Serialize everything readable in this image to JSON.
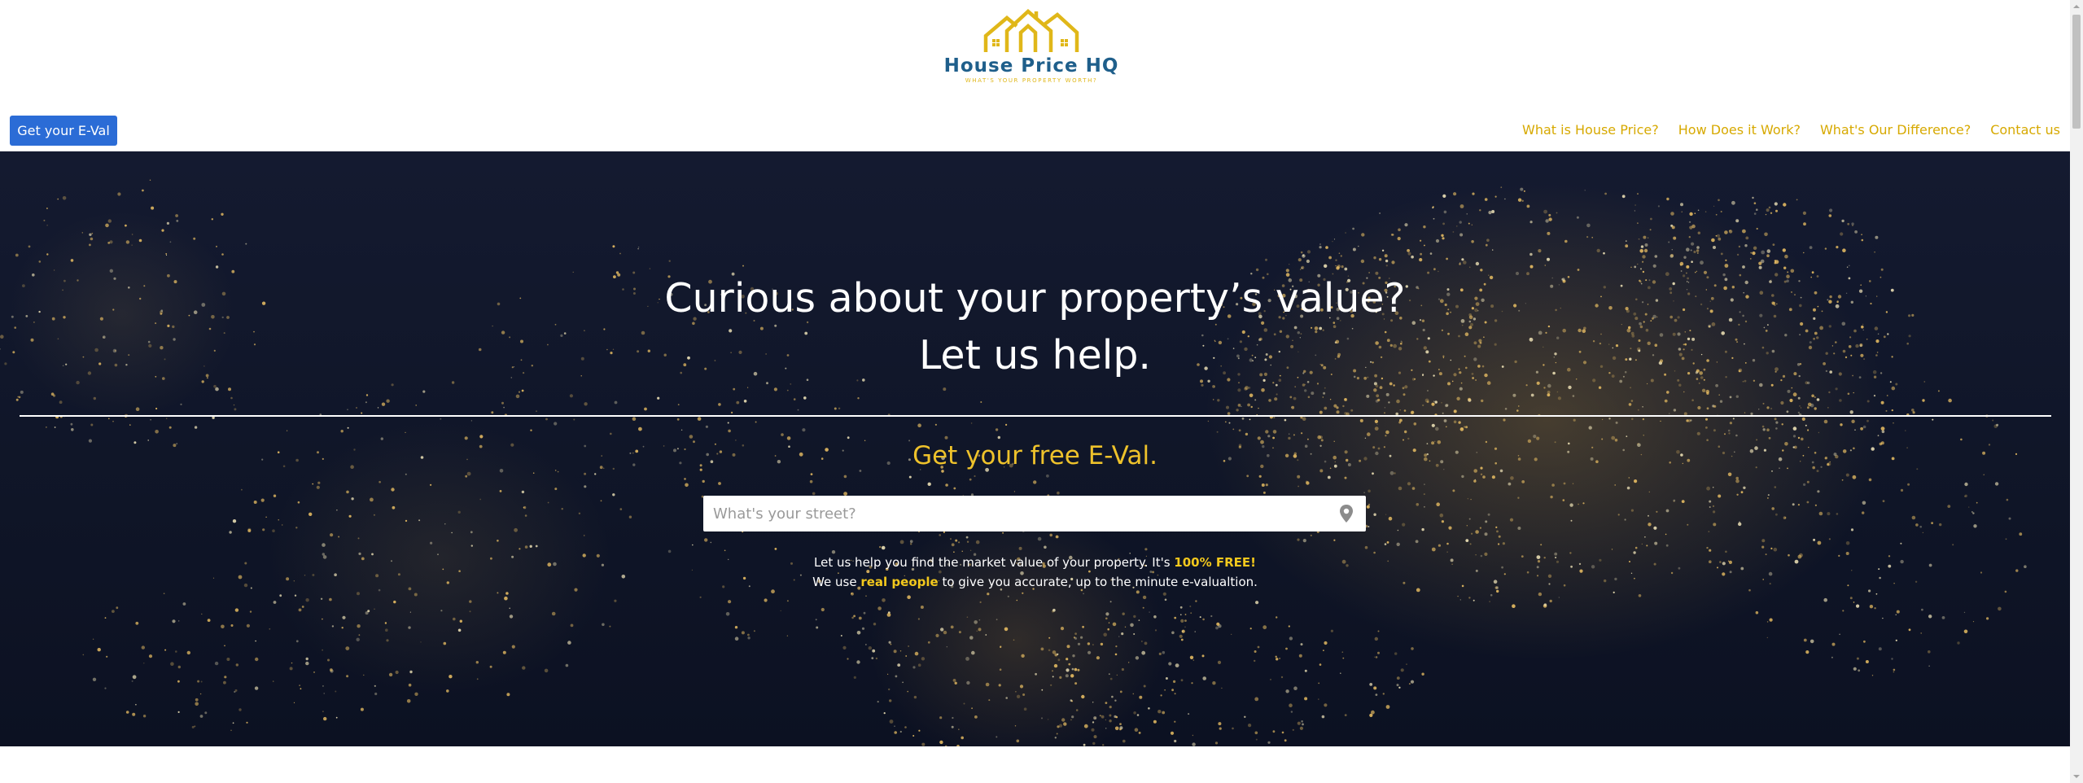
{
  "brand": {
    "name": "House Price HQ",
    "tagline": "WHAT'S YOUR PROPERTY WORTH?",
    "primary_color": "#1f5f8b",
    "accent_color": "#e0b719"
  },
  "header": {
    "cta_label": "Get your E-Val",
    "nav": [
      {
        "label": "What is House Price?"
      },
      {
        "label": "How Does it Work?"
      },
      {
        "label": "What's Our Difference?"
      },
      {
        "label": "Contact us"
      }
    ]
  },
  "hero": {
    "title_line1": "Curious about your property’s value?",
    "title_line2": "Let us help.",
    "subtitle": "Get your free E-Val.",
    "search": {
      "placeholder": "What's your street?",
      "value": "",
      "icon": "map-pin-icon"
    },
    "note": {
      "line1_text": "Let us help you find the market value of your property. It's ",
      "line1_highlight": "100% FREE!",
      "line2_pre": "We use ",
      "line2_highlight": "real people",
      "line2_post": " to give you accurate, up to the minute e-valualtion."
    },
    "background": "night-map-of-north-america"
  }
}
